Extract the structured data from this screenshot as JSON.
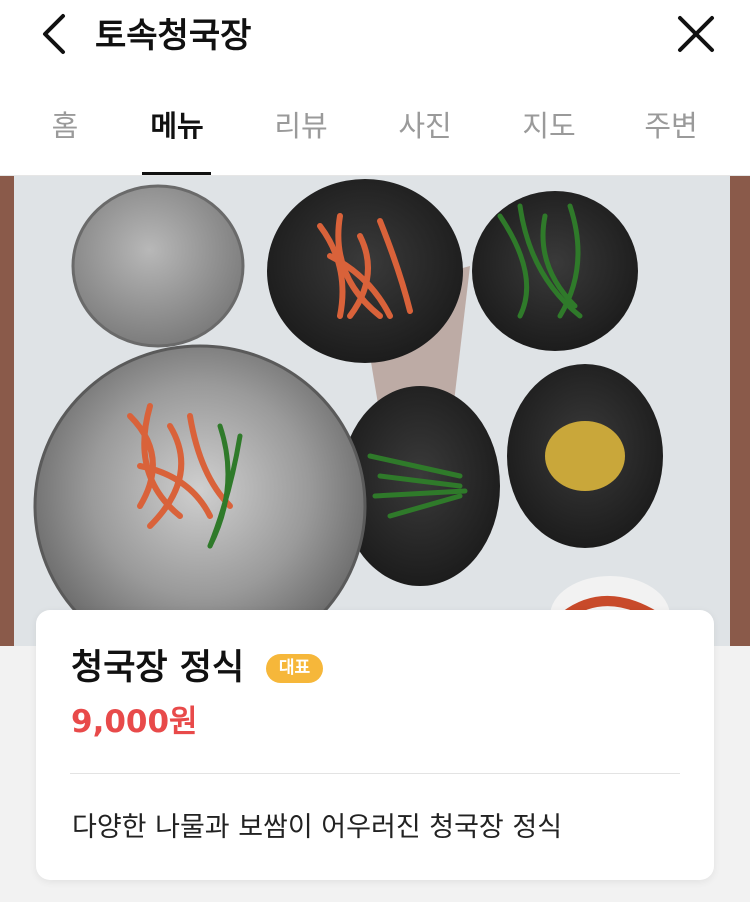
{
  "header": {
    "back_icon": "chevron-left-icon",
    "title": "토속청국장",
    "close_icon": "close-icon"
  },
  "tabs": [
    {
      "label": "홈",
      "active": false
    },
    {
      "label": "메뉴",
      "active": true
    },
    {
      "label": "리뷰",
      "active": false
    },
    {
      "label": "사진",
      "active": false
    },
    {
      "label": "지도",
      "active": false
    },
    {
      "label": "주변",
      "active": false
    }
  ],
  "menu_item": {
    "name": "청국장 정식",
    "badge": "대표",
    "price": "9,000원",
    "description": "다양한 나물과 보쌈이 어우러진 청국장 정식"
  },
  "colors": {
    "price": "#e84a4a",
    "badge": "#f6b73a",
    "active_tab": "#111111",
    "inactive_tab": "#9a9a9a"
  }
}
